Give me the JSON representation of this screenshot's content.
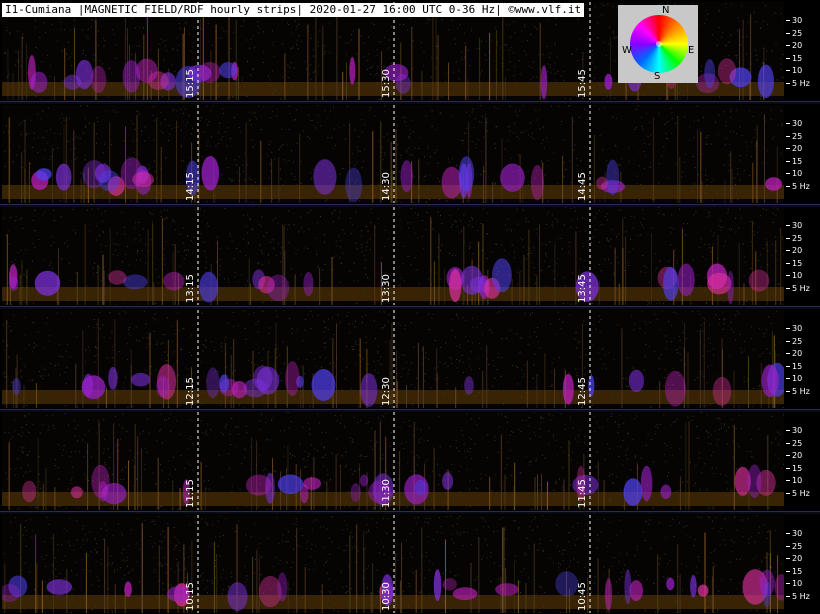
{
  "header": {
    "title": "I1-Cumiana |MAGNETIC FIELD/RDF hourly strips| 2020-01-27 16:00 UTC 0-36 Hz| ©www.vlf.it"
  },
  "compass": {
    "n": "N",
    "s": "S",
    "e": "E",
    "w": "W"
  },
  "axis": {
    "ticks": [
      "30",
      "25",
      "20",
      "15",
      "10",
      "5 Hz"
    ]
  },
  "strips": [
    {
      "times": [
        "15:15",
        "15:30",
        "15:45"
      ]
    },
    {
      "times": [
        "14:15",
        "14:30",
        "14:45"
      ]
    },
    {
      "times": [
        "13:15",
        "13:30",
        "13:45"
      ]
    },
    {
      "times": [
        "12:15",
        "12:30",
        "12:45"
      ]
    },
    {
      "times": [
        "11:15",
        "11:30",
        "11:45"
      ]
    },
    {
      "times": [
        "10:15",
        "10:30",
        "10:45"
      ]
    }
  ],
  "colors": {
    "background": "#000000",
    "header_bg": "#ffffff",
    "compass_bg": "#c8c8c8"
  }
}
